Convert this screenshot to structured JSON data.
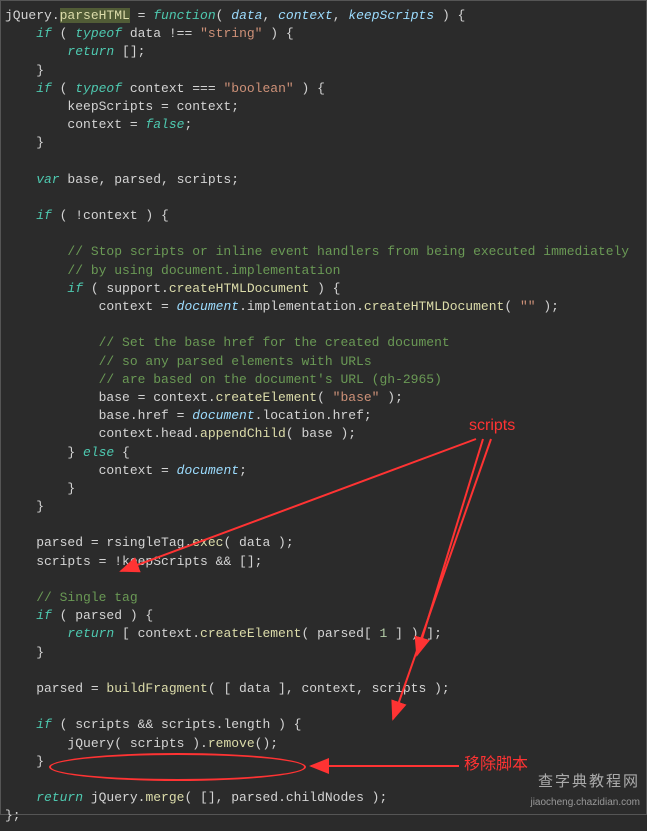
{
  "code": {
    "line1_a": "jQuery",
    "line1_b": ".",
    "line1_c": "parseHTML",
    "line1_d": " = ",
    "line1_e": "function",
    "line1_f": "( ",
    "line1_g": "data",
    "line1_h": ", ",
    "line1_i": "context",
    "line1_j": ", ",
    "line1_k": "keepScripts",
    "line1_l": " ) {",
    "line2_a": "    if",
    "line2_b": " ( ",
    "line2_c": "typeof",
    "line2_d": " data ",
    "line2_e": "!==",
    "line2_f": " ",
    "line2_g": "\"string\"",
    "line2_h": " ) {",
    "line3_a": "        return",
    "line3_b": " [];",
    "line4": "    }",
    "line5_a": "    if",
    "line5_b": " ( ",
    "line5_c": "typeof",
    "line5_d": " context ",
    "line5_e": "===",
    "line5_f": " ",
    "line5_g": "\"boolean\"",
    "line5_h": " ) {",
    "line6": "        keepScripts = context;",
    "line7_a": "        context = ",
    "line7_b": "false",
    "line7_c": ";",
    "line8": "    }",
    "line9": "",
    "line10_a": "    var",
    "line10_b": " base, parsed, scripts;",
    "line11": "",
    "line12_a": "    if",
    "line12_b": " ( !context ) {",
    "line13": "",
    "line14": "        // Stop scripts or inline event handlers from being executed immediately",
    "line15": "        // by using document.implementation",
    "line16_a": "        if",
    "line16_b": " ( support.",
    "line16_c": "createHTMLDocument",
    "line16_d": " ) {",
    "line17_a": "            context = ",
    "line17_b": "document",
    "line17_c": ".implementation.",
    "line17_d": "createHTMLDocument",
    "line17_e": "( ",
    "line17_f": "\"\"",
    "line17_g": " );",
    "line18": "",
    "line19": "            // Set the base href for the created document",
    "line20": "            // so any parsed elements with URLs",
    "line21": "            // are based on the document's URL (gh-2965)",
    "line22_a": "            base = context.",
    "line22_b": "createElement",
    "line22_c": "( ",
    "line22_d": "\"base\"",
    "line22_e": " );",
    "line23_a": "            base.href = ",
    "line23_b": "document",
    "line23_c": ".location.href;",
    "line24_a": "            context.head.",
    "line24_b": "appendChild",
    "line24_c": "( base );",
    "line25_a": "        } ",
    "line25_b": "else",
    "line25_c": " {",
    "line26_a": "            context = ",
    "line26_b": "document",
    "line26_c": ";",
    "line27": "        }",
    "line28": "    }",
    "line29": "",
    "line30_a": "    parsed = rsingleTag.",
    "line30_b": "exec",
    "line30_c": "( data );",
    "line31_a": "    scripts = !keepScripts ",
    "line31_b": "&&",
    "line31_c": " [];",
    "line32": "",
    "line33": "    // Single tag",
    "line34_a": "    if",
    "line34_b": " ( parsed ) {",
    "line35_a": "        return",
    "line35_b": " [ context.",
    "line35_c": "createElement",
    "line35_d": "( parsed[ ",
    "line35_e": "1",
    "line35_f": " ] ) ];",
    "line36": "    }",
    "line37": "",
    "line38_a": "    parsed = ",
    "line38_b": "buildFragment",
    "line38_c": "( [ data ], context, scripts );",
    "line39": "",
    "line40_a": "    if",
    "line40_b": " ( scripts ",
    "line40_c": "&&",
    "line40_d": " scripts.length ) {",
    "line41_a": "        jQuery( scripts ).",
    "line41_b": "remove",
    "line41_c": "();",
    "line42": "    }",
    "line43": "",
    "line44_a": "    return",
    "line44_b": " jQuery.",
    "line44_c": "merge",
    "line44_d": "( [], parsed.childNodes );",
    "line45": "};"
  },
  "annotations": {
    "scripts_label": "scripts",
    "remove_label": "移除脚本"
  },
  "watermark": {
    "line1": "查字典教程网",
    "line2": "jiaocheng.chazidian.com"
  }
}
